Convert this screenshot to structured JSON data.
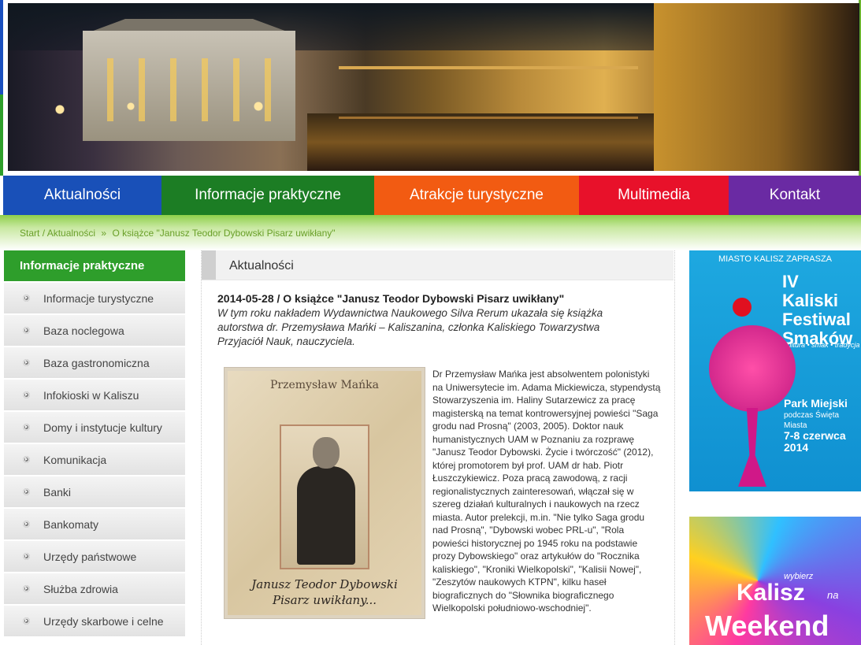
{
  "nav": {
    "items": [
      {
        "label": "Aktualności",
        "color": "#1950b8"
      },
      {
        "label": "Informacje praktyczne",
        "color": "#1c7d24"
      },
      {
        "label": "Atrakcje turystyczne",
        "color": "#f25b12"
      },
      {
        "label": "Multimedia",
        "color": "#e8112a"
      },
      {
        "label": "Kontakt",
        "color": "#6a2aa3"
      }
    ]
  },
  "breadcrumb": {
    "start": "Start",
    "sep1": "/",
    "section": "Aktualności",
    "sep2": "»",
    "current": "O książce \"Janusz Teodor Dybowski Pisarz uwikłany\""
  },
  "sidebar": {
    "heading": "Informacje praktyczne",
    "items": [
      "Informacje turystyczne",
      "Baza noclegowa",
      "Baza gastronomiczna",
      "Infokioski w Kaliszu",
      "Domy i instytucje kultury",
      "Komunikacja",
      "Banki",
      "Bankomaty",
      "Urzędy państwowe",
      "Służba zdrowia",
      "Urzędy skarbowe i celne"
    ]
  },
  "main": {
    "section_title": "Aktualności",
    "article_title": "2014-05-28 / O książce \"Janusz Teodor Dybowski Pisarz uwikłany\"",
    "lead": "W tym roku nakładem Wydawnictwa Naukowego Silva Rerum ukazała się książka autorstwa dr. Przemysława Mańki – Kaliszanina, członka Kaliskiego Towarzystwa Przyjaciół Nauk, nauczyciela.",
    "book": {
      "author": "Przemysław Mańka",
      "title_line1": "Janusz Teodor Dybowski",
      "title_line2": "Pisarz uwikłany..."
    },
    "body": "Dr Przemysław Mańka jest absolwentem polonistyki na Uniwersytecie im. Adama Mickiewicza, stypendystą Stowarzyszenia im. Haliny Sutarzewicz za pracę magisterską na temat kontrowersyjnej powieści \"Saga grodu nad Prosną\" (2003, 2005). Doktor nauk humanistycznych UAM w Poznaniu za rozprawę \"Janusz Teodor Dybowski. Życie i twórczość\" (2012), której promotorem był prof. UAM dr hab. Piotr Łuszczykiewicz. Poza pracą zawodową, z racji regionalistycznych zainteresowań, włączał się w szereg działań kulturalnych i naukowych na rzecz miasta. Autor prelekcji, m.in. \"Nie tylko Saga grodu nad Prosną\", \"Dybowski wobec PRL-u\", \"Rola powieści historycznej po 1945 roku na podstawie prozy Dybowskiego\" oraz artykułów do \"Rocznika kaliskiego\", \"Kroniki Wielkopolski\", \"Kalisii Nowej\", \"Zeszytów naukowych KTPN\", kilku haseł biograficznych do \"Słownika biograficznego Wielkopolski południowo-wschodniej\"."
  },
  "ads": {
    "festival": {
      "top": "MIASTO KALISZ ZAPRASZA",
      "title": "IV Kaliski Festiwal Smaków",
      "subtitle": "kultura • smak • tradycja",
      "place": "Park Miejski",
      "place_note": "podczas Święta Miasta",
      "dates": "7-8 czerwca 2014"
    },
    "weekend": {
      "t1": "wybierz",
      "t2": "Kalisz",
      "t3": "na",
      "t4": "Weekend"
    }
  },
  "colors": {
    "accent_green": "#2e9e2b",
    "breadcrumb_green": "#6aa02a"
  }
}
